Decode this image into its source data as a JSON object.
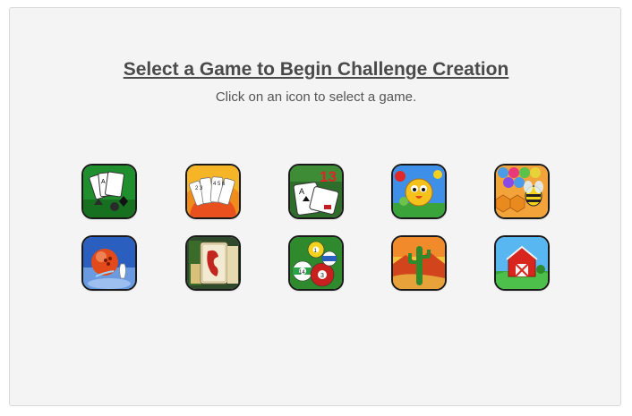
{
  "header": {
    "title": "Select a Game to Begin Challenge Creation",
    "subtitle": "Click on an icon to select a game."
  },
  "games": [
    {
      "icon": "spades-cards-icon",
      "accent": "#1e8a2c"
    },
    {
      "icon": "rummy-cards-fan-icon",
      "accent": "#f08c1c"
    },
    {
      "icon": "thirteen-cards-icon",
      "accent": "#2e6e2a"
    },
    {
      "icon": "bird-bubble-shooter-icon",
      "accent": "#2f7fd8"
    },
    {
      "icon": "bee-bubble-shooter-icon",
      "accent": "#d47a1e"
    },
    {
      "icon": "bowling-ball-icon",
      "accent": "#2a5fbf"
    },
    {
      "icon": "mahjong-dragon-tile-icon",
      "accent": "#3b6b2a"
    },
    {
      "icon": "pool-billiard-balls-icon",
      "accent": "#2f8a2e"
    },
    {
      "icon": "desert-cactus-icon",
      "accent": "#e0481c"
    },
    {
      "icon": "red-barn-farm-icon",
      "accent": "#3a9ae0"
    }
  ]
}
